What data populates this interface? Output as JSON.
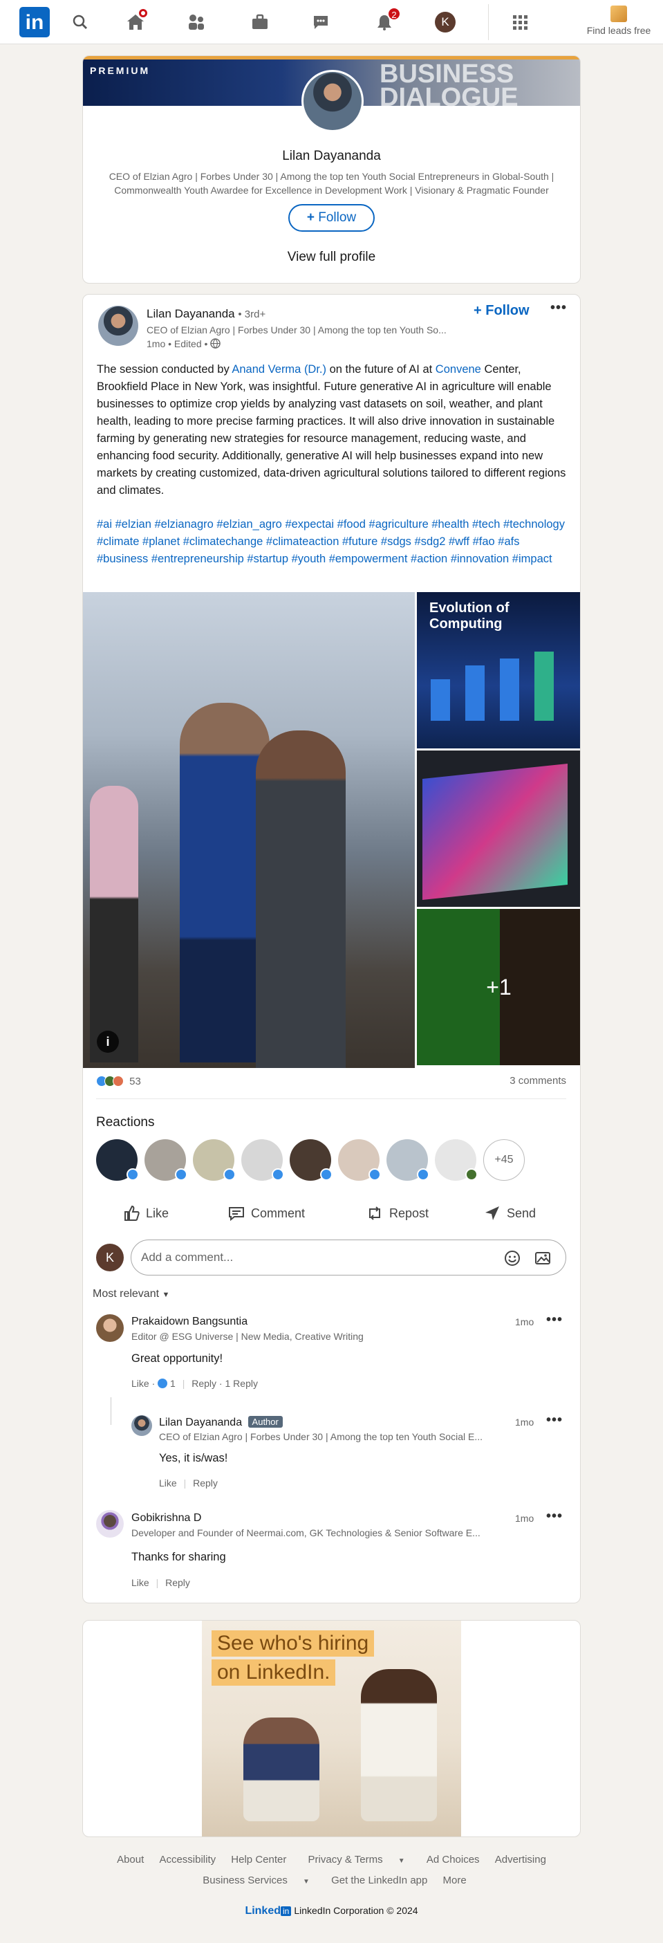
{
  "nav": {
    "logo": "in",
    "messaging_count": "",
    "notifications_count": "2",
    "me_initial": "K",
    "find_leads": "Find leads free"
  },
  "profile_card": {
    "banner_label": "PREMIUM",
    "banner_text": "BUSINESS DIALOGUE",
    "name": "Lilan Dayananda",
    "headline": "CEO of Elzian Agro | Forbes Under 30 | Among the top ten Youth Social Entrepreneurs in Global-South | Commonwealth Youth Awardee for Excellence in Development Work | Visionary & Pragmatic Founder",
    "follow_label": "Follow",
    "view_profile": "View full profile"
  },
  "post": {
    "author": "Lilan Dayananda",
    "degree": "• 3rd+",
    "headline": "CEO of Elzian Agro | Forbes Under 30 | Among the top ten Youth So...",
    "time": "1mo • Edited •",
    "follow_label": "Follow",
    "text_1": "The session conducted by ",
    "link_1": "Anand Verma (Dr.)",
    "text_2": " on the future of AI at ",
    "link_2": "Convene",
    "text_3": " Center, Brookfield Place in New York, was insightful. Future generative AI in agriculture will enable businesses to optimize crop yields by analyzing vast datasets on soil, weather, and plant health, leading to more precise farming practices. It will also drive innovation in sustainable farming by generating new strategies for resource management, reducing waste, and enhancing food security. Additionally, generative AI will help businesses expand into new markets by creating customized, data-driven agricultural solutions tailored to different regions and climates.",
    "hashtags": "#ai #elzian #elzianagro #elzian_agro #expectai #food #agriculture #health #tech #technology #climate #planet #climatechange #climateaction #future #sdgs #sdg2 #wff #fao #afs #business #entrepreneurship #startup #youth #empowerment #action #innovation #impact",
    "image_title": "Evolution of Computing",
    "more_images": "+1",
    "reaction_count": "53",
    "comment_count": "3 comments",
    "reactions_title": "Reactions",
    "more_reactors": "+45",
    "actions": {
      "like": "Like",
      "comment": "Comment",
      "repost": "Repost",
      "send": "Send"
    }
  },
  "comment_box": {
    "avatar_initial": "K",
    "placeholder": "Add a comment..."
  },
  "sort_label": "Most relevant",
  "comments": [
    {
      "name": "Prakaidown Bangsuntia",
      "headline": "Editor @ ESG Universe | New Media, Creative Writing",
      "time": "1mo",
      "text": "Great opportunity!",
      "like": "Like",
      "like_count": "1",
      "reply": "Reply",
      "replies": "1 Reply"
    },
    {
      "name": "Lilan Dayananda",
      "badge": "Author",
      "headline": "CEO of Elzian Agro | Forbes Under 30 | Among the top ten Youth Social E...",
      "time": "1mo",
      "text": "Yes, it is/was!",
      "like": "Like",
      "reply": "Reply"
    },
    {
      "name": "Gobikrishna D",
      "headline": "Developer and Founder of Neermai.com, GK Technologies & Senior Software E...",
      "time": "1mo",
      "text": "Thanks for sharing",
      "like": "Like",
      "reply": "Reply"
    }
  ],
  "ad": {
    "line1": "See who's hiring",
    "line2": "on LinkedIn."
  },
  "footer": {
    "row1": [
      "About",
      "Accessibility",
      "Help Center",
      "Privacy & Terms",
      "Ad Choices",
      "Advertising"
    ],
    "row2": [
      "Business Services",
      "Get the LinkedIn app",
      "More"
    ],
    "brand_word": "Linked",
    "brand_in": "in",
    "copyright": "LinkedIn Corporation © 2024"
  },
  "colors": {
    "brand": "#0a66c2",
    "background": "#f4f2ee",
    "notification": "#cc1016",
    "premium_gold": "#e7a33e"
  }
}
